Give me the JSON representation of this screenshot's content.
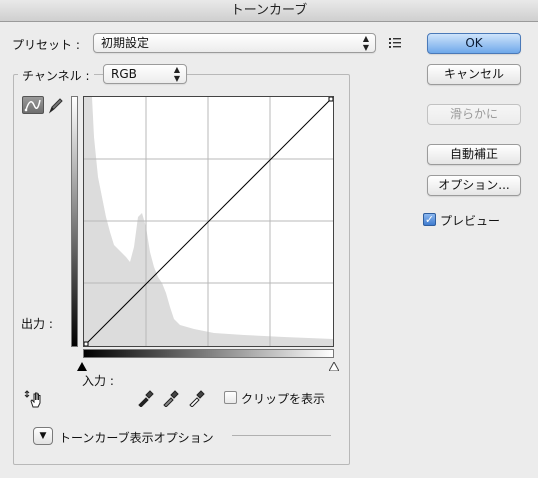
{
  "window": {
    "title": "トーンカーブ"
  },
  "preset": {
    "label": "プリセット :",
    "value": "初期設定"
  },
  "channel": {
    "label": "チャンネル :",
    "value": "RGB"
  },
  "buttons": {
    "ok": "OK",
    "cancel": "キャンセル",
    "smooth": "滑らかに",
    "auto": "自動補正",
    "options": "オプション..."
  },
  "preview": {
    "label": "プレビュー",
    "checked": true
  },
  "axis": {
    "output_label": "出力 :",
    "input_label": "入力 :"
  },
  "clipping": {
    "label": "クリップを表示",
    "checked": false
  },
  "display_options": {
    "label": "トーンカーブ表示オプション"
  },
  "icons": {
    "curve_tool": "curve-point-icon",
    "pencil_tool": "pencil-icon",
    "preset_menu": "preset-options-icon",
    "on_image_adjust": "hand-adjust-icon",
    "black_point": "eyedropper-black-icon",
    "gray_point": "eyedropper-gray-icon",
    "white_point": "eyedropper-white-icon",
    "expand": "disclosure-triangle-icon"
  },
  "colors": {
    "accent": "#6fa8ea",
    "histogram": "#dcdcdc"
  }
}
